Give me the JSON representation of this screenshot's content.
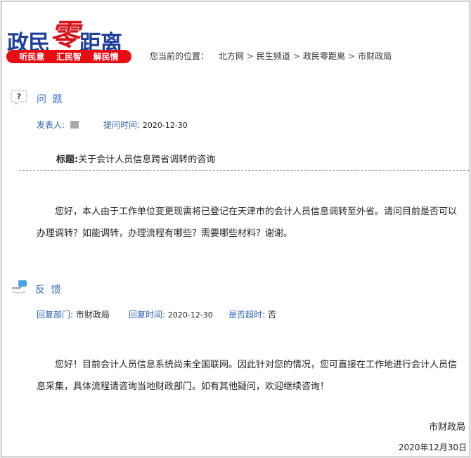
{
  "logo": {
    "part1": "政民",
    "part2": "零",
    "part3": "距离"
  },
  "slogans": [
    "听民意",
    "汇民智",
    "解民情"
  ],
  "breadcrumb": {
    "label": "您当前的位置：",
    "items": [
      "北方网",
      "民生频道",
      "政民零距离",
      "市财政局"
    ],
    "separator": ">"
  },
  "question": {
    "section_title": "问 题",
    "icon": "question-bubble-icon",
    "poster_label": "发表人:",
    "time_label": "提问时间:",
    "time_value": "2020-12-30",
    "subject_label": "标题:",
    "subject": "关于会计人员信息跨省调转的咨询",
    "body": "您好，本人由于工作单位变更现需将已登记在天津市的会计人员信息调转至外省。请问目前是否可以办理调转？如能调转，办理流程有哪些？需要哪些材料？谢谢。"
  },
  "feedback": {
    "section_title": "反 馈",
    "icon": "chat-bubble-icon",
    "dept_label": "回复部门:",
    "dept_value": "市财政局",
    "time_label": "回复时间:",
    "time_value": "2020-12-30",
    "overtime_label": "是否超时:",
    "overtime_value": "否",
    "body": "您好！目前会计人员信息系统尚未全国联网。因此针对您的情况，您可直接在工作地进行会计人员信息采集，具体流程请咨询当地财政部门。如有其他疑问，欢迎继续咨询！",
    "signature": "市财政局",
    "date": "2020年12月30日"
  },
  "colors": {
    "brand_blue": "#1f3f9c",
    "brand_red": "#e60d12",
    "meta_blue": "#2a62b3"
  }
}
